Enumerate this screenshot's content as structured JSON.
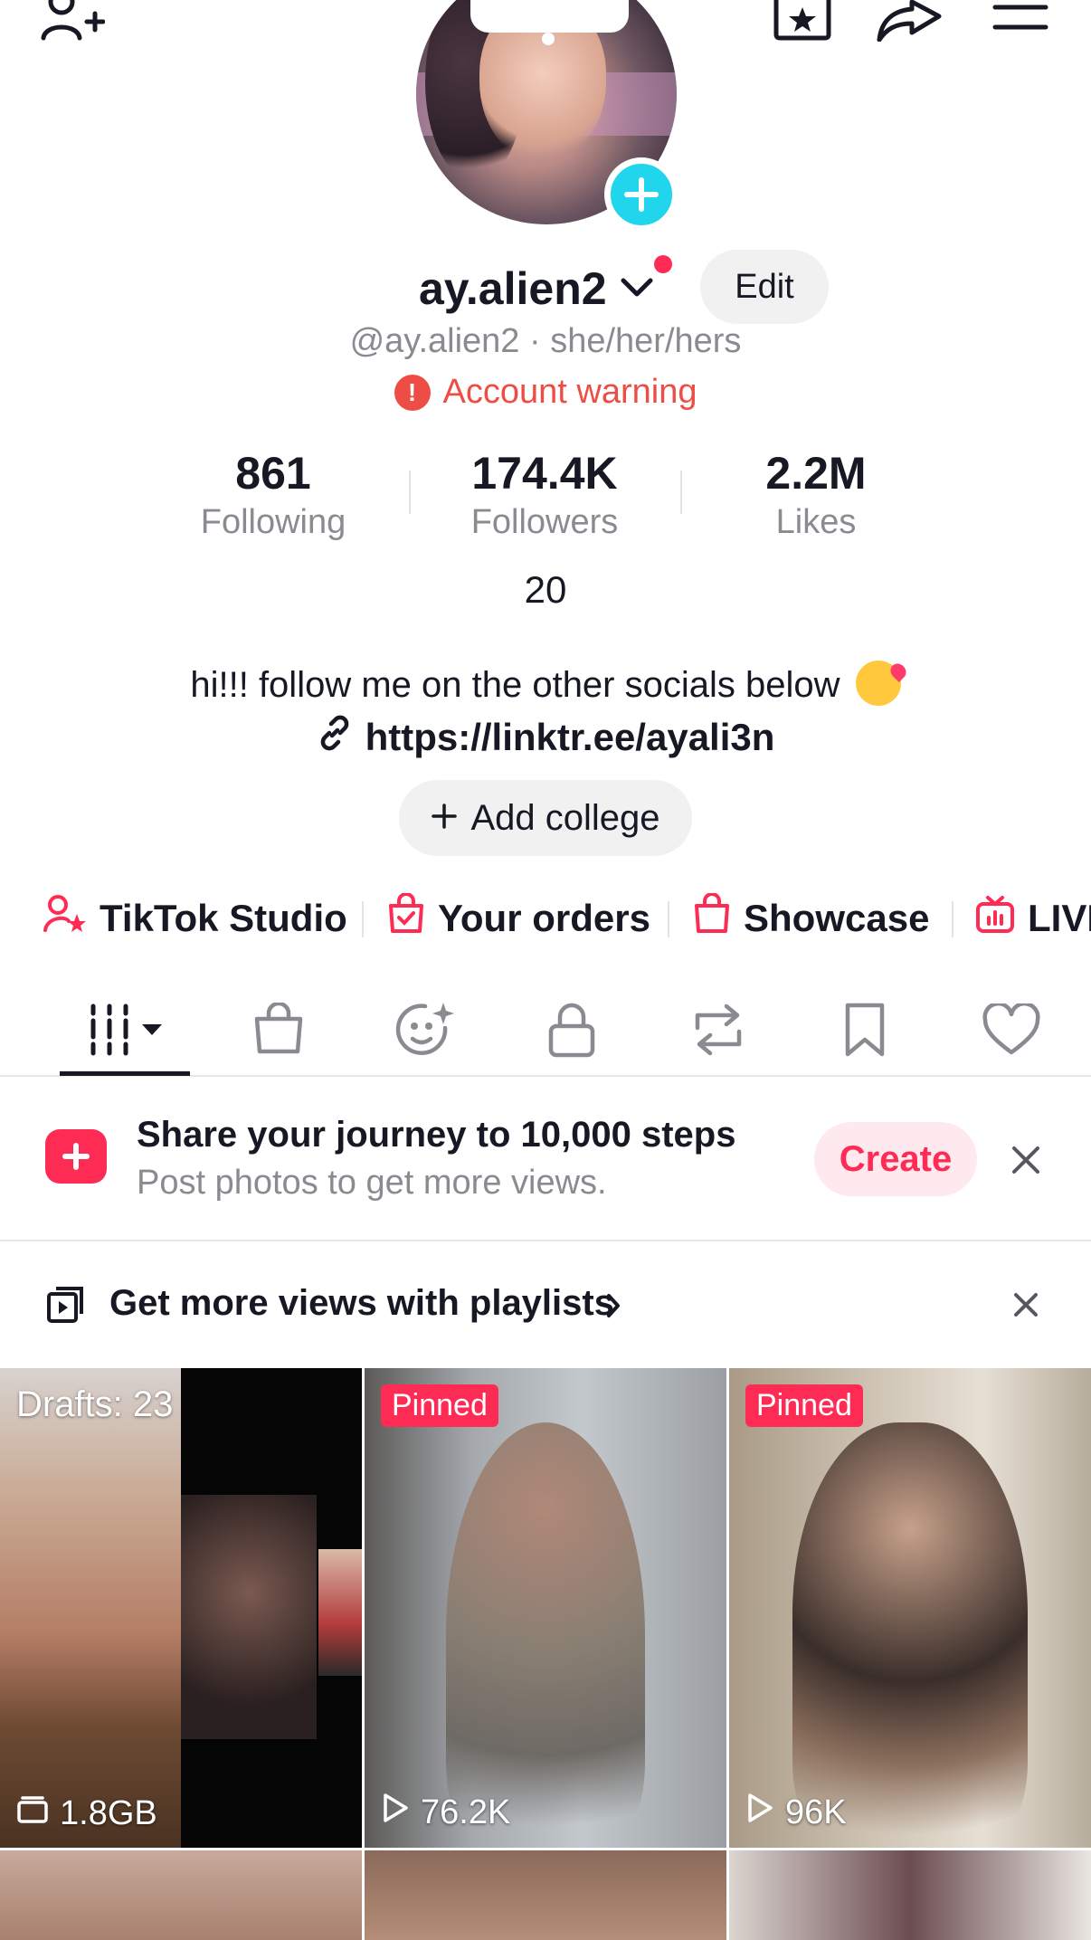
{
  "header": {
    "add_friend_icon": "person-plus-icon",
    "favorites_icon": "star-box-icon",
    "share_icon": "share-arrow-icon",
    "menu_icon": "hamburger-menu-icon"
  },
  "profile": {
    "username": "ay.alien2",
    "edit_label": "Edit",
    "handle_line": "@ay.alien2 · she/her/hers",
    "warning_text": "Account warning",
    "stats": [
      {
        "value": "861",
        "label": "Following"
      },
      {
        "value": "174.4K",
        "label": "Followers"
      },
      {
        "value": "2.2M",
        "label": "Likes"
      }
    ],
    "age": "20",
    "bio": "hi!!! follow me on the other socials below",
    "link": "https://linktr.ee/ayali3n",
    "add_college_label": "Add college"
  },
  "shortcuts": [
    {
      "label": "TikTok Studio",
      "icon": "creator-star-icon"
    },
    {
      "label": "Your orders",
      "icon": "orders-bag-icon"
    },
    {
      "label": "Showcase",
      "icon": "shopping-bag-icon"
    },
    {
      "label": "LIVE",
      "icon": "live-tv-icon"
    }
  ],
  "tabs": [
    {
      "name": "videos",
      "icon": "grid-bars-icon",
      "active": true
    },
    {
      "name": "shop",
      "icon": "shopping-bag-icon"
    },
    {
      "name": "ai-self",
      "icon": "sparkle-face-icon"
    },
    {
      "name": "private",
      "icon": "lock-icon"
    },
    {
      "name": "reposts",
      "icon": "repost-icon"
    },
    {
      "name": "favorites",
      "icon": "bookmark-icon"
    },
    {
      "name": "liked",
      "icon": "heart-icon"
    }
  ],
  "banner": {
    "title": "Share your journey to 10,000 steps",
    "subtitle": "Post photos to get more views.",
    "create_label": "Create"
  },
  "playlist": {
    "text": "Get more views with playlists"
  },
  "grid": [
    {
      "overlay": "Drafts: 23",
      "stat": "1.8GB",
      "stat_icon": "drafts-box-icon"
    },
    {
      "overlay": "Pinned",
      "stat": "76.2K",
      "stat_icon": "play-icon"
    },
    {
      "overlay": "Pinned",
      "stat": "96K",
      "stat_icon": "play-icon"
    }
  ],
  "colors": {
    "accent": "#fe2c55",
    "cyan": "#20d5ec",
    "warning": "#ee4d45",
    "secondary_text": "#8a8b91"
  }
}
